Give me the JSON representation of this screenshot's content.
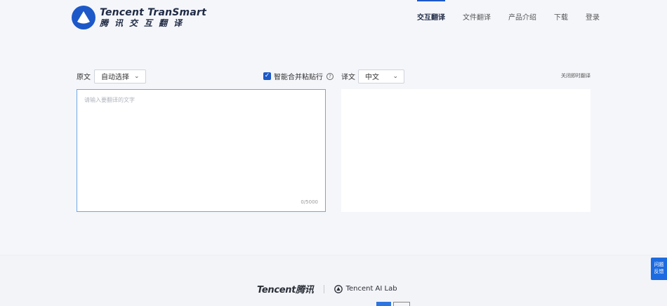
{
  "header": {
    "logo_en": "Tencent TranSmart",
    "logo_cn": "腾讯交互翻译",
    "nav": [
      {
        "label": "交互翻译",
        "active": true
      },
      {
        "label": "文件翻译",
        "active": false
      },
      {
        "label": "产品介绍",
        "active": false
      },
      {
        "label": "下载",
        "active": false
      },
      {
        "label": "登录",
        "active": false
      }
    ]
  },
  "source": {
    "label": "原文",
    "language": "自动选择",
    "merge_checked": true,
    "merge_label": "智能合并粘贴行",
    "placeholder": "请输入要翻译的文字",
    "counter": "0/5000"
  },
  "target": {
    "label": "译文",
    "language": "中文",
    "instant_toggle": "关闭即时翻译"
  },
  "footer": {
    "brand": "Tencent腾讯",
    "lab": "Tencent AI Lab"
  },
  "feedback": {
    "line1": "问题",
    "line2": "反馈"
  },
  "colors": {
    "accent": "#1c58c8",
    "focus_border": "#6ea8e0",
    "background": "#f5f6fa"
  }
}
